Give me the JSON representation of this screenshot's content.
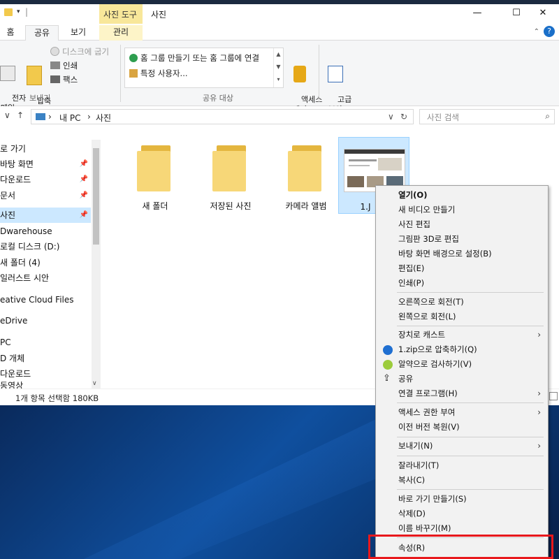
{
  "window": {
    "title": "사진",
    "context_tab": "사진 도구",
    "controls": {
      "minimize": "—",
      "maximize": "☐",
      "close": "✕"
    }
  },
  "ribbon_tabs": [
    "홈",
    "공유",
    "보기",
    "관리"
  ],
  "ribbon": {
    "send_group": {
      "email_label": "전자\n메일",
      "zip_label": "압축\n(ZIP)",
      "burn_label": "디스크에 굽기",
      "print_label": "인쇄",
      "fax_label": "팩스",
      "group_label": "보내기"
    },
    "share_group": {
      "item1": "홈 그룹 만들기 또는 홈 그룹에 연결",
      "item2": "특정 사용자...",
      "group_label": "공유 대상"
    },
    "remove_access_label": "액세스\n제거",
    "advanced_security_label": "고급\n보안"
  },
  "address": {
    "crumbs": [
      "내 PC",
      "사진"
    ],
    "search_placeholder": "사진 검색"
  },
  "sidebar": {
    "items": [
      {
        "label": "로 가기",
        "pinned": false
      },
      {
        "label": "바탕 화면",
        "pinned": true
      },
      {
        "label": "다운로드",
        "pinned": true
      },
      {
        "label": "문서",
        "pinned": true
      },
      {
        "label": "사진",
        "pinned": true,
        "selected": true
      },
      {
        "label": "Dwarehouse",
        "pinned": false
      },
      {
        "label": "로컬 디스크 (D:)",
        "pinned": false
      },
      {
        "label": "새 폴더 (4)",
        "pinned": false
      },
      {
        "label": "일러스트 시안",
        "pinned": false
      },
      {
        "label": "eative Cloud Files",
        "pinned": false
      },
      {
        "label": "eDrive",
        "pinned": false
      },
      {
        "label": "PC",
        "pinned": false
      },
      {
        "label": "D 개체",
        "pinned": false
      },
      {
        "label": "다운로드",
        "pinned": false
      },
      {
        "label": "동영상",
        "pinned": false
      }
    ]
  },
  "files": [
    {
      "label": "새 폴더",
      "type": "folder"
    },
    {
      "label": "저장된 사진",
      "type": "folder"
    },
    {
      "label": "카메라 앨범",
      "type": "folder"
    },
    {
      "label": "1.J",
      "type": "image",
      "selected": true
    }
  ],
  "status": "1개 항목 선택함 180KB",
  "context_menu": {
    "items": [
      {
        "label": "열기(O)",
        "bold": true
      },
      {
        "label": "새 비디오 만들기"
      },
      {
        "label": "사진 편집"
      },
      {
        "label": "그림판 3D로 편집"
      },
      {
        "label": "바탕 화면 배경으로 설정(B)"
      },
      {
        "label": "편집(E)"
      },
      {
        "label": "인쇄(P)"
      },
      {
        "label": "오른쪽으로 회전(T)"
      },
      {
        "label": "왼쪽으로 회전(L)"
      },
      {
        "label": "장치로 캐스트",
        "submenu": true
      },
      {
        "label": "1.zip으로 압축하기(Q)",
        "icon": "bandizip-icon"
      },
      {
        "label": "알약으로 검사하기(V)",
        "icon": "alyac-icon"
      },
      {
        "label": "공유",
        "icon": "share-icon"
      },
      {
        "label": "연결 프로그램(H)",
        "submenu": true
      },
      {
        "label": "액세스 권한 부여",
        "submenu": true
      },
      {
        "label": "이전 버전 복원(V)"
      },
      {
        "label": "보내기(N)",
        "submenu": true
      },
      {
        "label": "잘라내기(T)"
      },
      {
        "label": "복사(C)"
      },
      {
        "label": "바로 가기 만들기(S)"
      },
      {
        "label": "삭제(D)"
      },
      {
        "label": "이름 바꾸기(M)"
      },
      {
        "label": "속성(R)",
        "highlighted": true
      }
    ]
  },
  "colors": {
    "selection": "#cce8ff",
    "context_tab": "#f8e79a",
    "highlight_box": "#e8181c",
    "folder": "#f7d778",
    "desktop": "#0f4f9e"
  }
}
